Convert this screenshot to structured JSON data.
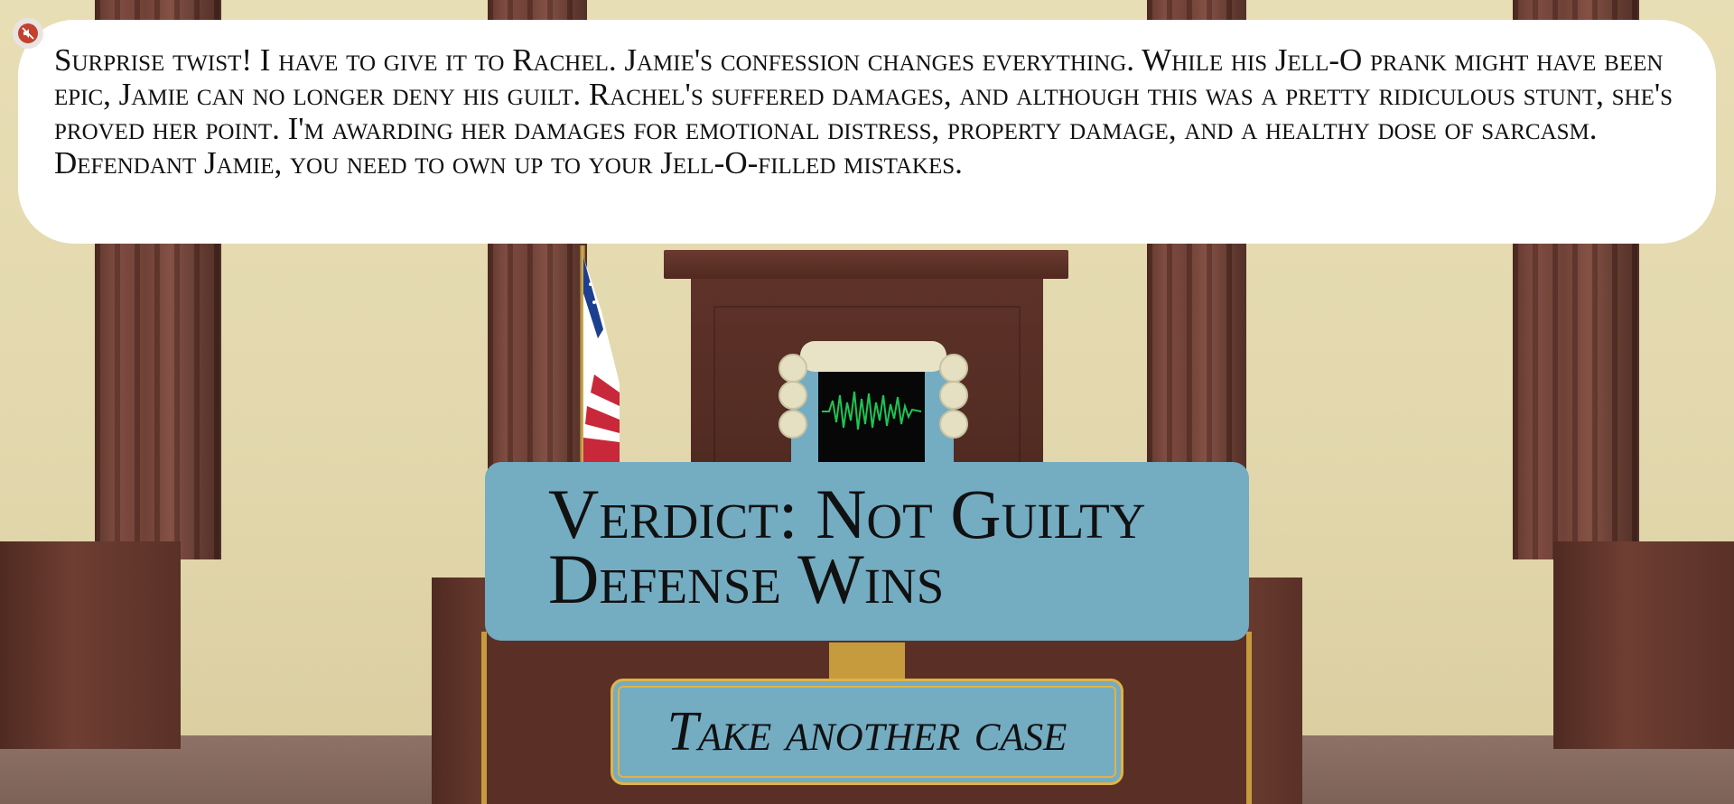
{
  "speech": {
    "text": "Surprise twist! I have to give it to Rachel. Jamie's confession changes everything. While his Jell-O prank might have been epic, Jamie can no longer deny his guilt. Rachel's suffered damages, and although this was a pretty ridiculous stunt, she's proved her point. I'm awarding her damages for emotional distress, property damage, and a healthy dose of sarcasm. Defendant Jamie, you need to own up to your Jell-O-filled mistakes."
  },
  "mute_button": {
    "icon": "mute-icon"
  },
  "verdict": {
    "line1": "Verdict: Not Guilty",
    "line2": "Defense Wins"
  },
  "actions": {
    "take_another_case": "Take another case"
  },
  "colors": {
    "panel": "#74acc2",
    "button_border": "#e0b347",
    "wood": "#6b3a2f",
    "wall": "#e6dcb4"
  }
}
